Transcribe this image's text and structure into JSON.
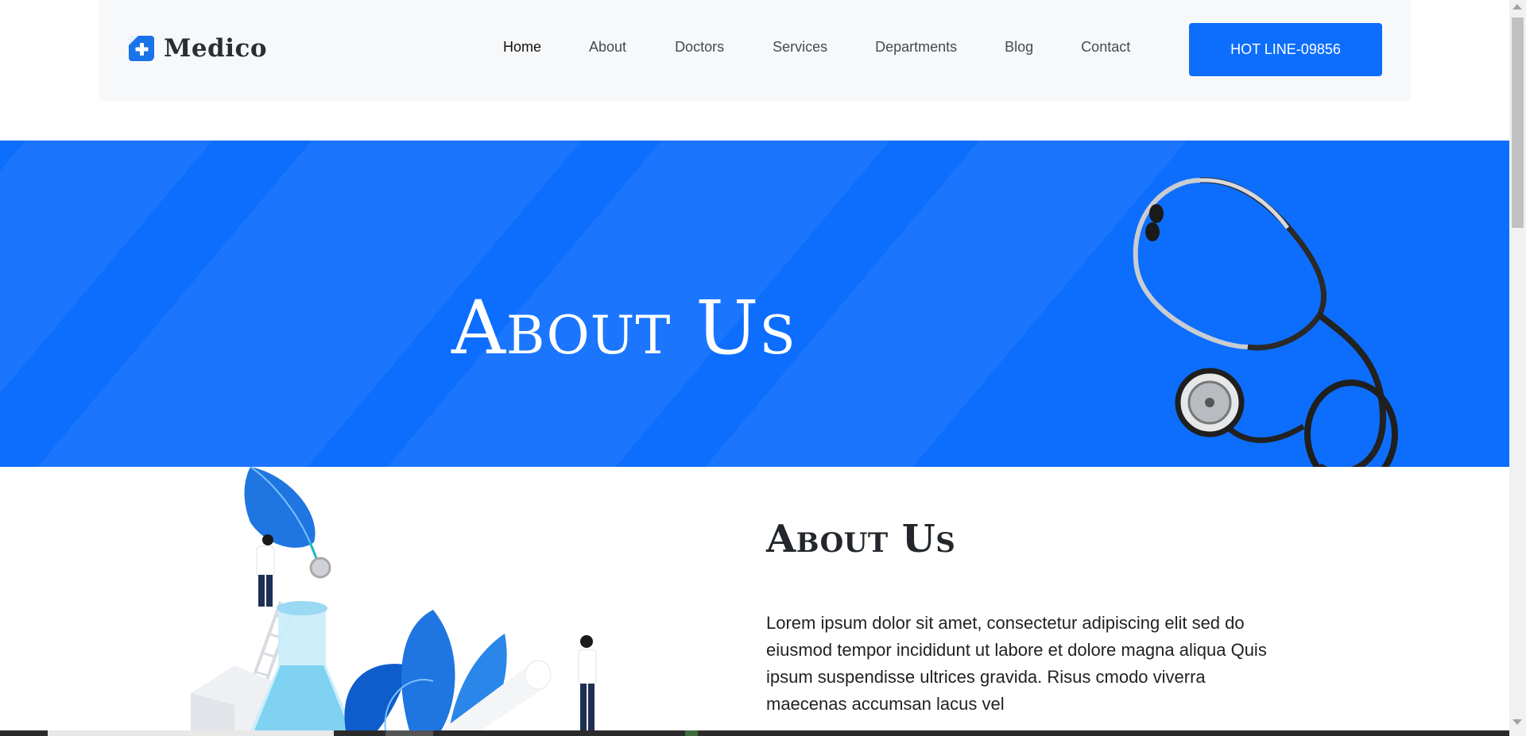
{
  "header": {
    "logo_text": "Medico",
    "nav": [
      {
        "label": "Home",
        "active": true
      },
      {
        "label": "About",
        "active": false
      },
      {
        "label": "Doctors",
        "active": false
      },
      {
        "label": "Services",
        "active": false
      },
      {
        "label": "Departments",
        "active": false
      },
      {
        "label": "Blog",
        "active": false
      },
      {
        "label": "Contact",
        "active": false
      }
    ],
    "hotline_label": "HOT LINE-09856"
  },
  "hero": {
    "title": "About Us",
    "image": "stethoscope-image"
  },
  "about": {
    "heading": "About Us",
    "paragraph": "Lorem ipsum dolor sit amet, consectetur adipiscing elit sed do eiusmod tempor incididunt ut labore et dolore magna aliqua Quis ipsum suspendisse ultrices gravida. Risus cmodo viverra maecenas accumsan lacus vel",
    "image": "laboratory-illustration"
  },
  "colors": {
    "primary": "#0d6efd",
    "header_bg": "#f7f8f9",
    "text_dark": "#23272b"
  }
}
